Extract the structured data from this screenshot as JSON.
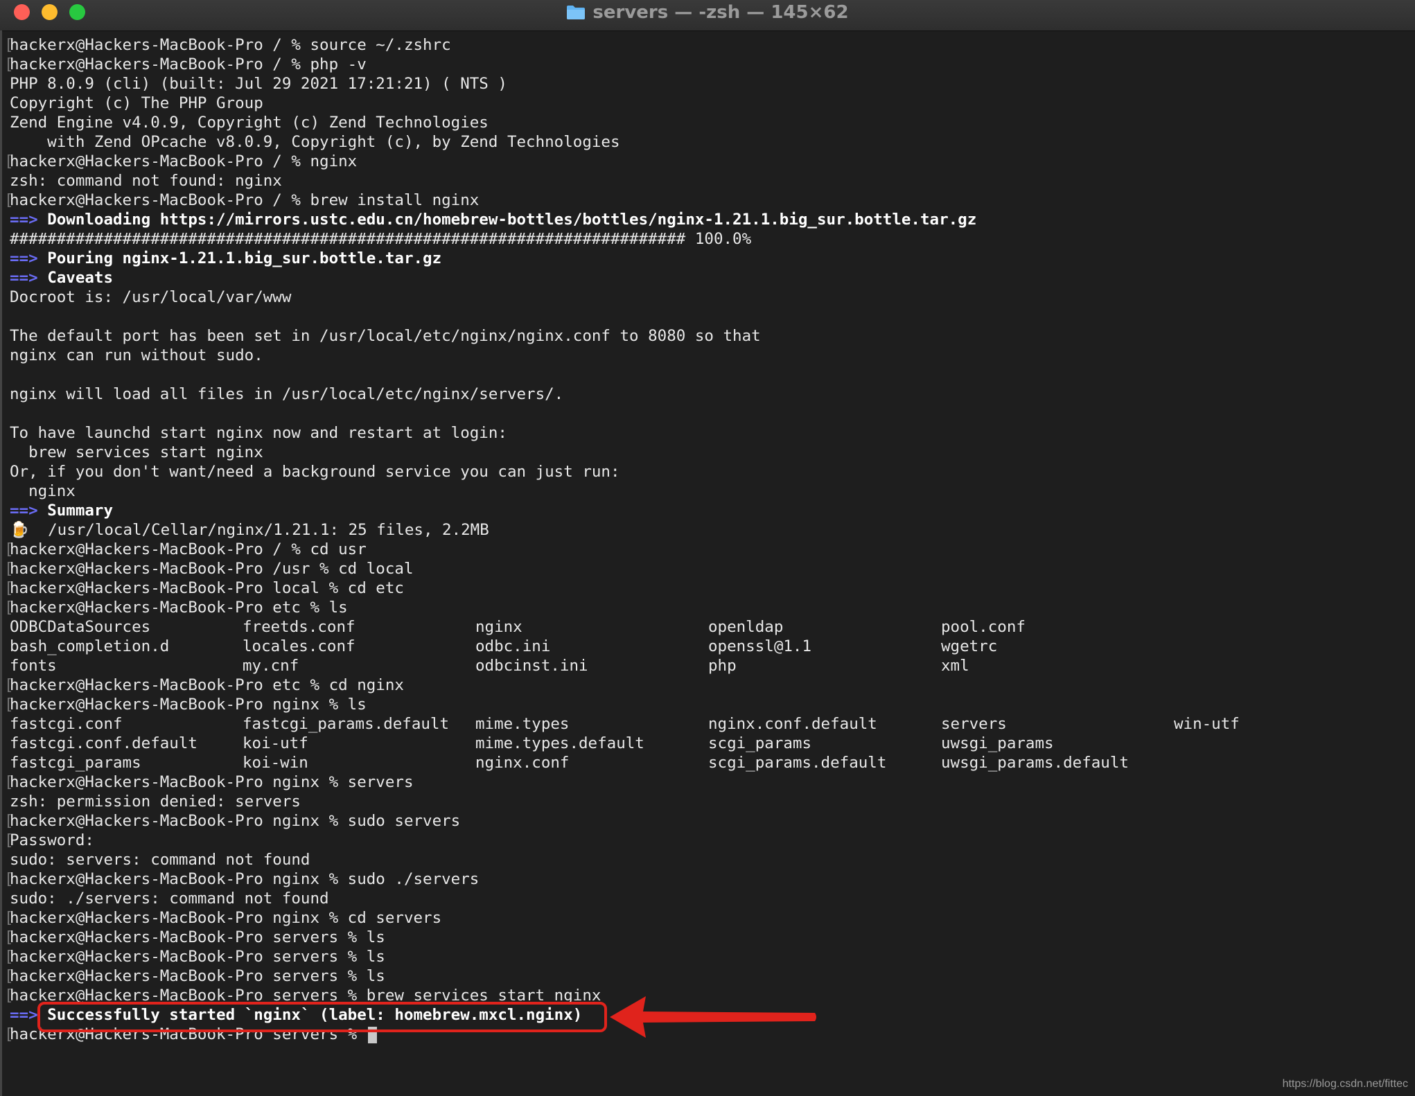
{
  "window": {
    "title": "servers — -zsh — 145×62"
  },
  "terminal": {
    "lines": [
      {
        "type": "prompt",
        "text": "hackerx@Hackers-MacBook-Pro / % source ~/.zshrc"
      },
      {
        "type": "prompt",
        "text": "hackerx@Hackers-MacBook-Pro / % php -v"
      },
      {
        "type": "text",
        "text": "PHP 8.0.9 (cli) (built: Jul 29 2021 17:21:21) ( NTS )"
      },
      {
        "type": "text",
        "text": "Copyright (c) The PHP Group"
      },
      {
        "type": "text",
        "text": "Zend Engine v4.0.9, Copyright (c) Zend Technologies"
      },
      {
        "type": "text",
        "text": "    with Zend OPcache v8.0.9, Copyright (c), by Zend Technologies"
      },
      {
        "type": "prompt",
        "text": "hackerx@Hackers-MacBook-Pro / % nginx"
      },
      {
        "type": "text",
        "text": "zsh: command not found: nginx"
      },
      {
        "type": "prompt",
        "text": "hackerx@Hackers-MacBook-Pro / % brew install nginx"
      },
      {
        "type": "brew",
        "arrow": "==>",
        "text": "Downloading https://mirrors.ustc.edu.cn/homebrew-bottles/bottles/nginx-1.21.1.big_sur.bottle.tar.gz"
      },
      {
        "type": "text",
        "text": "######################################################################## 100.0%"
      },
      {
        "type": "brew",
        "arrow": "==>",
        "text": "Pouring nginx-1.21.1.big_sur.bottle.tar.gz"
      },
      {
        "type": "brew",
        "arrow": "==>",
        "text": "Caveats"
      },
      {
        "type": "text",
        "text": "Docroot is: /usr/local/var/www"
      },
      {
        "type": "text",
        "text": ""
      },
      {
        "type": "text",
        "text": "The default port has been set in /usr/local/etc/nginx/nginx.conf to 8080 so that"
      },
      {
        "type": "text",
        "text": "nginx can run without sudo."
      },
      {
        "type": "text",
        "text": ""
      },
      {
        "type": "text",
        "text": "nginx will load all files in /usr/local/etc/nginx/servers/."
      },
      {
        "type": "text",
        "text": ""
      },
      {
        "type": "text",
        "text": "To have launchd start nginx now and restart at login:"
      },
      {
        "type": "text",
        "text": "  brew services start nginx"
      },
      {
        "type": "text",
        "text": "Or, if you don't want/need a background service you can just run:"
      },
      {
        "type": "text",
        "text": "  nginx"
      },
      {
        "type": "brew",
        "arrow": "==>",
        "text": "Summary"
      },
      {
        "type": "text",
        "text": "🍺  /usr/local/Cellar/nginx/1.21.1: 25 files, 2.2MB"
      },
      {
        "type": "prompt",
        "text": "hackerx@Hackers-MacBook-Pro / % cd usr"
      },
      {
        "type": "prompt",
        "text": "hackerx@Hackers-MacBook-Pro /usr % cd local"
      },
      {
        "type": "prompt",
        "text": "hackerx@Hackers-MacBook-Pro local % cd etc"
      },
      {
        "type": "prompt",
        "text": "hackerx@Hackers-MacBook-Pro etc % ls"
      },
      {
        "type": "cols",
        "cols": [
          "ODBCDataSources",
          "freetds.conf",
          "nginx",
          "openldap",
          "pool.conf"
        ]
      },
      {
        "type": "cols",
        "cols": [
          "bash_completion.d",
          "locales.conf",
          "odbc.ini",
          "openssl@1.1",
          "wgetrc"
        ]
      },
      {
        "type": "cols",
        "cols": [
          "fonts",
          "my.cnf",
          "odbcinst.ini",
          "php",
          "xml"
        ]
      },
      {
        "type": "prompt",
        "text": "hackerx@Hackers-MacBook-Pro etc % cd nginx"
      },
      {
        "type": "prompt",
        "text": "hackerx@Hackers-MacBook-Pro nginx % ls"
      },
      {
        "type": "cols",
        "cols": [
          "fastcgi.conf",
          "fastcgi_params.default",
          "mime.types",
          "nginx.conf.default",
          "servers",
          "win-utf"
        ]
      },
      {
        "type": "cols",
        "cols": [
          "fastcgi.conf.default",
          "koi-utf",
          "mime.types.default",
          "scgi_params",
          "uwsgi_params"
        ]
      },
      {
        "type": "cols",
        "cols": [
          "fastcgi_params",
          "koi-win",
          "nginx.conf",
          "scgi_params.default",
          "uwsgi_params.default"
        ]
      },
      {
        "type": "prompt",
        "text": "hackerx@Hackers-MacBook-Pro nginx % servers"
      },
      {
        "type": "text",
        "text": "zsh: permission denied: servers"
      },
      {
        "type": "prompt",
        "text": "hackerx@Hackers-MacBook-Pro nginx % sudo servers"
      },
      {
        "type": "prompt",
        "text": "Password:"
      },
      {
        "type": "text",
        "text": "sudo: servers: command not found"
      },
      {
        "type": "prompt",
        "text": "hackerx@Hackers-MacBook-Pro nginx % sudo ./servers"
      },
      {
        "type": "text",
        "text": "sudo: ./servers: command not found"
      },
      {
        "type": "prompt",
        "text": "hackerx@Hackers-MacBook-Pro nginx % cd servers"
      },
      {
        "type": "prompt",
        "text": "hackerx@Hackers-MacBook-Pro servers % ls"
      },
      {
        "type": "prompt",
        "text": "hackerx@Hackers-MacBook-Pro servers % ls"
      },
      {
        "type": "prompt",
        "text": "hackerx@Hackers-MacBook-Pro servers % ls"
      },
      {
        "type": "prompt",
        "text": "hackerx@Hackers-MacBook-Pro servers % brew services start nginx"
      },
      {
        "type": "brew",
        "arrow": "==>",
        "text": "Successfully started `nginx` (label: homebrew.mxcl.nginx)"
      },
      {
        "type": "current",
        "text": "hackerx@Hackers-MacBook-Pro servers % "
      }
    ]
  },
  "annotation": {
    "color": "#e0231c"
  },
  "watermark": "https://blog.csdn.net/fittec"
}
